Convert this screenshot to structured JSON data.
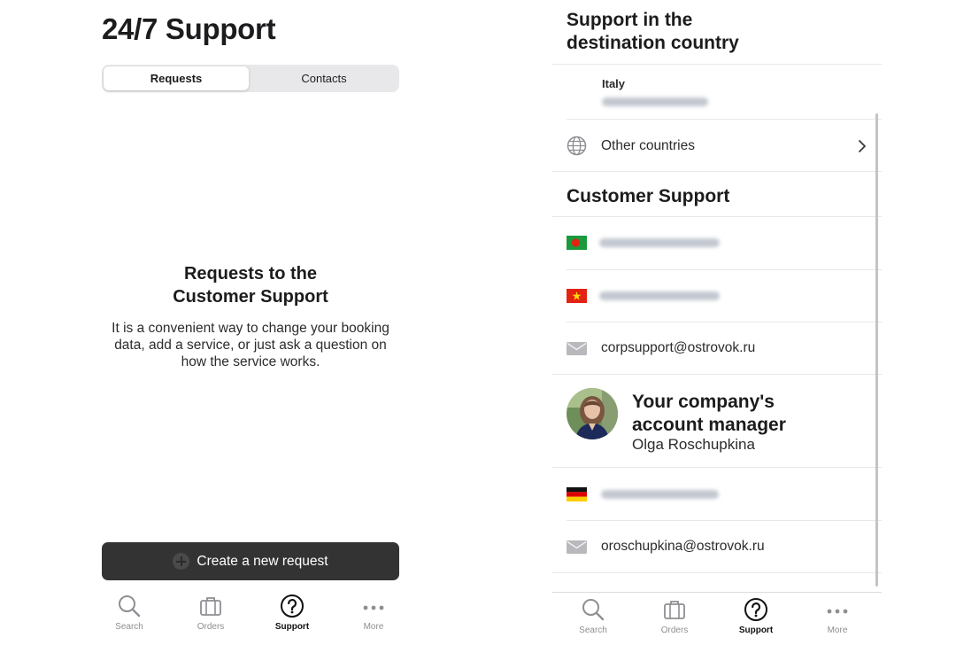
{
  "left": {
    "title": "24/7 Support",
    "tabs": [
      {
        "label": "Requests",
        "active": true
      },
      {
        "label": "Contacts",
        "active": false
      }
    ],
    "empty_state": {
      "title_line1": "Requests to the",
      "title_line2": "Customer Support",
      "body_line1": "It is a convenient way to change your booking",
      "body_line2": "data, add a service, or just ask a question on",
      "body_line3": "how the service works."
    },
    "create_button": "Create a new request",
    "tabbar": [
      {
        "label": "Search",
        "icon": "search-icon"
      },
      {
        "label": "Orders",
        "icon": "suitcase-icon"
      },
      {
        "label": "Support",
        "icon": "question-circle-icon",
        "active": true
      },
      {
        "label": "More",
        "icon": "more-dots-icon"
      }
    ]
  },
  "right": {
    "section1_line1": "Support in the",
    "section1_line2": "destination country",
    "italy": "Italy",
    "other_countries": "Other countries",
    "customer_support": "Customer Support",
    "email1": "corpsupport@ostrovok.ru",
    "manager_title_line1": "Your company's",
    "manager_title_line2": "account manager",
    "manager_name": "Olga Roschupkina",
    "email2": "oroschupkina@ostrovok.ru",
    "tabbar": [
      {
        "label": "Search",
        "icon": "search-icon"
      },
      {
        "label": "Orders",
        "icon": "suitcase-icon"
      },
      {
        "label": "Support",
        "icon": "question-circle-icon",
        "active": true
      },
      {
        "label": "More",
        "icon": "more-dots-icon"
      }
    ]
  },
  "colors": {
    "button_bg": "#333333",
    "segment_bg": "#e8e8ea",
    "icon_gray": "#8e8e93",
    "flag_green": "#1a9a3c",
    "flag_red": "#e32213"
  }
}
